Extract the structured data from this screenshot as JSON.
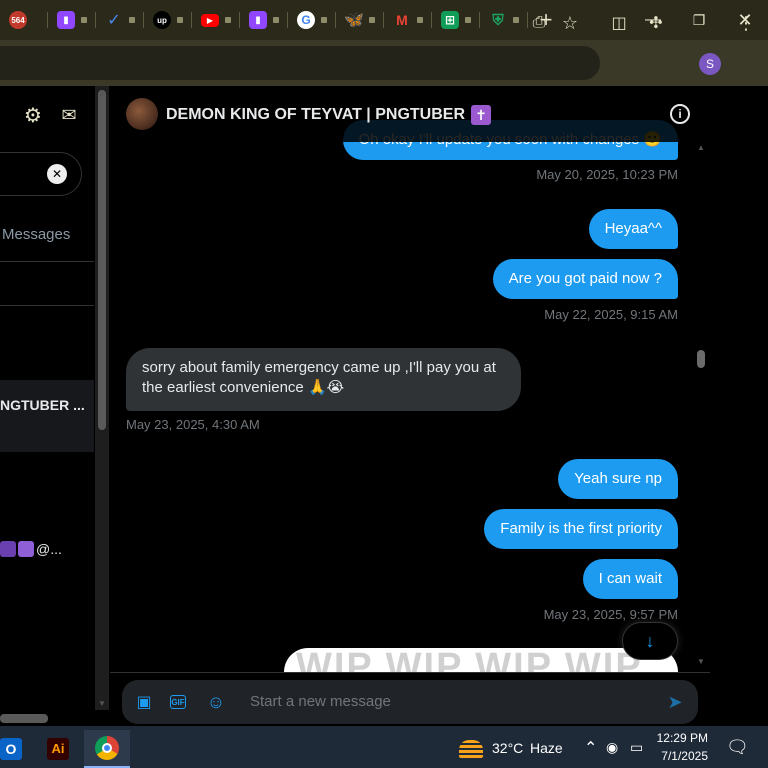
{
  "browser": {
    "tabs": [
      {
        "icon": "discord-notification-icon",
        "badge": "564",
        "color": "#5865f2"
      },
      {
        "icon": "twitch-icon",
        "color": "#9146ff"
      },
      {
        "icon": "task-check-icon",
        "color": "#4c8bf5"
      },
      {
        "icon": "upwork-icon",
        "label": "up",
        "color": "#000000"
      },
      {
        "icon": "youtube-icon",
        "color": "#ff0000"
      },
      {
        "icon": "twitch-icon",
        "color": "#9146ff"
      },
      {
        "icon": "google-icon",
        "color": "#ffffff"
      },
      {
        "icon": "bluesky-icon",
        "color": "#1185fe"
      },
      {
        "icon": "gmail-icon",
        "color": "#ffffff"
      },
      {
        "icon": "sheets-icon",
        "color": "#0f9d58"
      },
      {
        "icon": "shield-extension-icon",
        "color": "#1aa260"
      }
    ],
    "profile_initial": "S"
  },
  "sidebar": {
    "tab_label": "Messages",
    "conversation_title": "NGTUBER ...",
    "conversation_preview": "@..."
  },
  "chat": {
    "name": "DEMON KING OF TEYVAT | PNGTUBER",
    "badge_glyph": "✝",
    "messages": [
      {
        "dir": "out",
        "text": "Oh okay I'll update you soon with changes 🙂"
      },
      {
        "dir": "ts",
        "text": "May 20, 2025, 10:23 PM"
      },
      {
        "dir": "out",
        "text": "Heyaa^^"
      },
      {
        "dir": "out",
        "text": "Are you got paid now ?"
      },
      {
        "dir": "ts",
        "text": "May 22, 2025, 9:15 AM"
      },
      {
        "dir": "in",
        "line1": "sorry about family emergency came up ,I'll pay you at",
        "line2": "the earliest convenience 🙏😭"
      },
      {
        "dir": "ts",
        "text": "May 23, 2025, 4:30 AM"
      },
      {
        "dir": "out",
        "text": "Yeah sure np"
      },
      {
        "dir": "out",
        "text": "Family is the first priority"
      },
      {
        "dir": "out",
        "text": "I can wait"
      },
      {
        "dir": "ts",
        "text": "May 23, 2025, 9:57 PM"
      }
    ],
    "attachment_watermark": "WIP WIP WIP WIP",
    "composer_placeholder": "Start a new message"
  },
  "taskbar": {
    "temperature": "32°C",
    "weather": "Haze",
    "time": "12:29 PM",
    "date": "7/1/2025",
    "apps": [
      "outlook",
      "illustrator",
      "chrome"
    ],
    "illustrator_label": "Ai"
  },
  "colors": {
    "accent": "#1d9bf0",
    "incoming_bubble": "#2f3336",
    "tabbar": "#2b2a1a"
  }
}
